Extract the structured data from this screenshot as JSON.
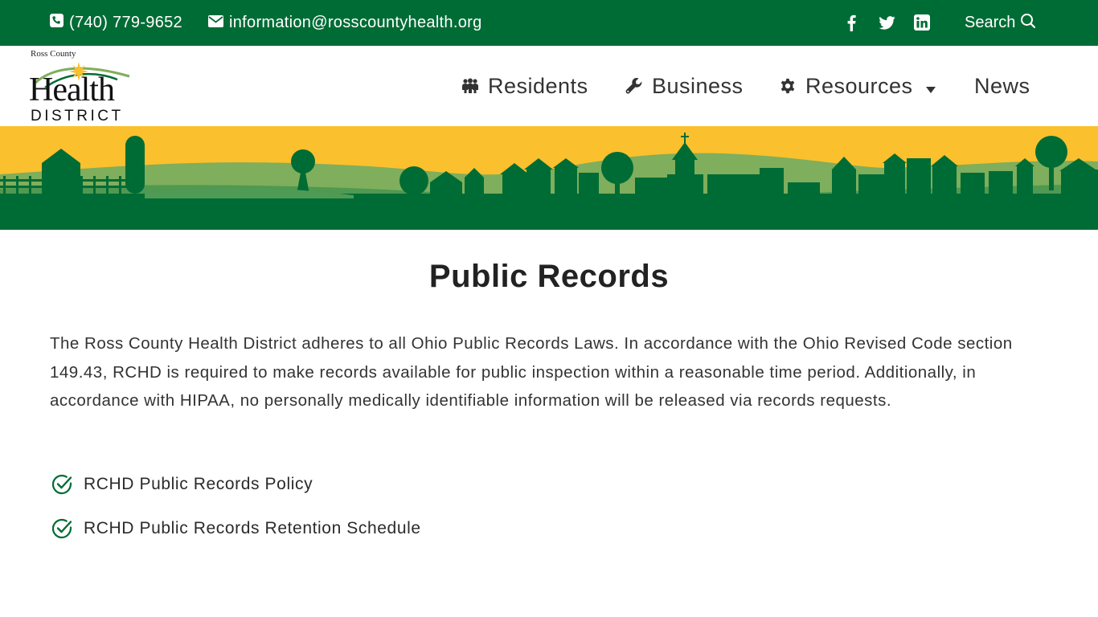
{
  "topbar": {
    "phone": "(740) 779-9652",
    "email": "information@rosscountyhealth.org",
    "social": [
      "facebook-icon",
      "twitter-icon",
      "linkedin-icon"
    ],
    "search_label": "Search"
  },
  "logo": {
    "small": "Ross County",
    "health": "Health",
    "district": "DISTRICT"
  },
  "nav": {
    "residents": "Residents",
    "business": "Business",
    "resources": "Resources",
    "news": "News"
  },
  "main": {
    "title": "Public Records",
    "intro": "The Ross County Health District adheres to all Ohio Public Records Laws. In accordance with the Ohio Revised Code section 149.43, RCHD is required to make records available for public inspection within a reasonable time period. Additionally, in accordance with HIPAA, no personally medically identifiable information will be released via records requests.",
    "links": [
      {
        "label": "RCHD Public Records Policy",
        "icon": "check-circle-icon"
      },
      {
        "label": "RCHD Public Records Retention Schedule",
        "icon": "check-circle-icon"
      }
    ]
  },
  "colors": {
    "brand_green": "#006c35",
    "banner_yellow": "#fbc02d",
    "hill_green": "#7fae5c"
  }
}
